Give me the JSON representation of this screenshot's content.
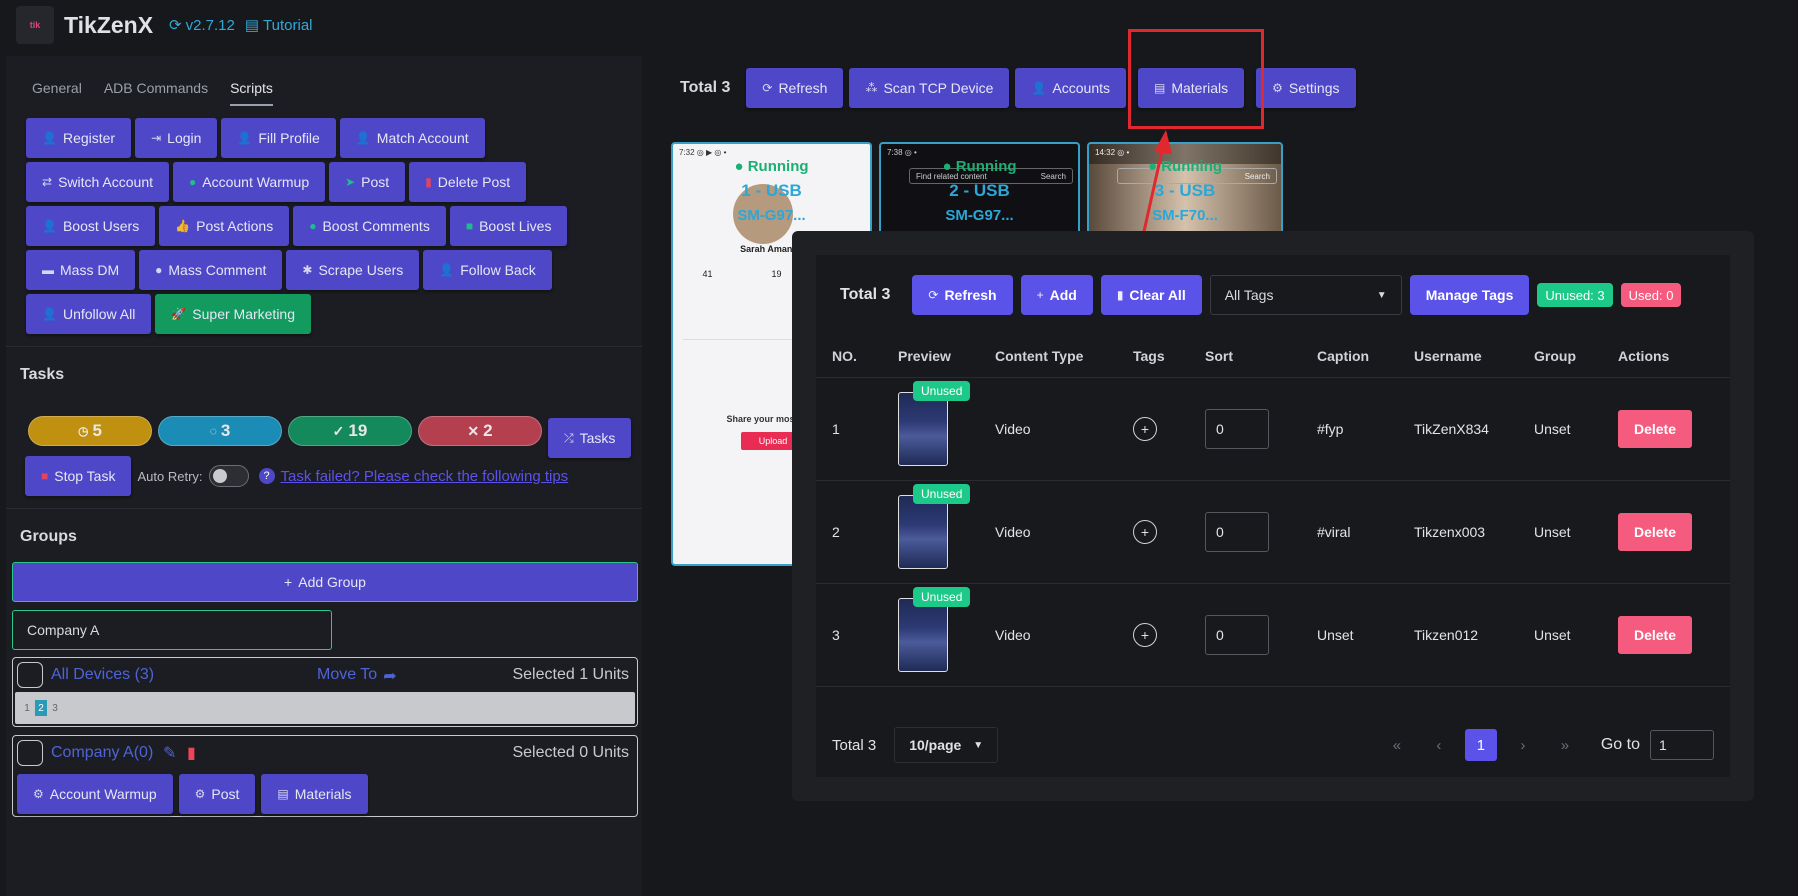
{
  "header": {
    "logo_text": "tik",
    "title": "TikZenX",
    "version": "v2.7.12",
    "tutorial": "Tutorial"
  },
  "left_tabs": [
    "General",
    "ADB Commands",
    "Scripts"
  ],
  "scripts": {
    "row1": [
      "Register",
      "Login",
      "Fill Profile",
      "Match Account"
    ],
    "row2": [
      "Switch Account",
      "Account Warmup",
      "Post",
      "Delete Post"
    ],
    "row3": [
      "Boost Users",
      "Post Actions",
      "Boost Comments",
      "Boost Lives"
    ],
    "row4": [
      "Mass DM",
      "Mass Comment",
      "Scrape Users",
      "Follow Back"
    ],
    "row5": [
      "Unfollow All",
      "Super Marketing"
    ]
  },
  "tasks": {
    "title": "Tasks",
    "pending": "5",
    "running": "3",
    "done": "19",
    "failed": "2",
    "tasks_button": "Tasks",
    "stop_button": "Stop Task",
    "auto_retry": "Auto Retry:",
    "tip_link": "Task failed? Please check the following tips"
  },
  "groups": {
    "title": "Groups",
    "add_group": "Add Group",
    "group_input": "Company A",
    "all_devices": "All Devices (3)",
    "move_to": "Move To",
    "selected_all": "Selected 1 Units",
    "device_numbers": [
      "1",
      "2",
      "3"
    ],
    "company_group": "Company A(0)",
    "selected_company": "Selected 0 Units",
    "group_actions": [
      "Account Warmup",
      "Post",
      "Materials"
    ]
  },
  "device_toolbar": {
    "total": "Total 3",
    "buttons": [
      "Refresh",
      "Scan TCP Device",
      "Accounts",
      "Materials",
      "Settings"
    ]
  },
  "devices": [
    {
      "status": "Running",
      "usb": "1 - USB",
      "model": "SM-G97...",
      "profile": "Sarah Amanda",
      "cta": "Upload",
      "share": "Share your most pop"
    },
    {
      "status": "Running",
      "usb": "2 - USB",
      "model": "SM-G97...",
      "search": "Find related content",
      "search_btn": "Search"
    },
    {
      "status": "Running",
      "usb": "3 - USB",
      "model": "SM-F70...",
      "search_btn": "Search"
    }
  ],
  "modal": {
    "total": "Total 3",
    "refresh": "Refresh",
    "add": "Add",
    "clear_all": "Clear All",
    "tags_select": "All Tags",
    "manage_tags": "Manage Tags",
    "unused_badge": "Unused: 3",
    "used_badge": "Used: 0",
    "columns": [
      "NO.",
      "Preview",
      "Content Type",
      "Tags",
      "Sort",
      "Caption",
      "Username",
      "Group",
      "Actions"
    ],
    "rows": [
      {
        "no": "1",
        "chip": "Unused",
        "type": "Video",
        "sort": "0",
        "caption": "#fyp",
        "username": "TikZenX834",
        "group": "Unset",
        "action": "Delete"
      },
      {
        "no": "2",
        "chip": "Unused",
        "type": "Video",
        "sort": "0",
        "caption": "#viral",
        "username": "Tikzenx003",
        "group": "Unset",
        "action": "Delete"
      },
      {
        "no": "3",
        "chip": "Unused",
        "type": "Video",
        "sort": "0",
        "caption": "Unset",
        "username": "Tikzen012",
        "group": "Unset",
        "action": "Delete"
      }
    ],
    "pager": {
      "total": "Total 3",
      "page_size": "10/page",
      "current": "1",
      "goto_label": "Go to",
      "goto_value": "1"
    }
  },
  "colors": {
    "primary": "#4e47c7",
    "accent": "#5b52ea",
    "green": "#129a5f",
    "highlight": "#e0282e",
    "danger": "#f45b7f"
  }
}
